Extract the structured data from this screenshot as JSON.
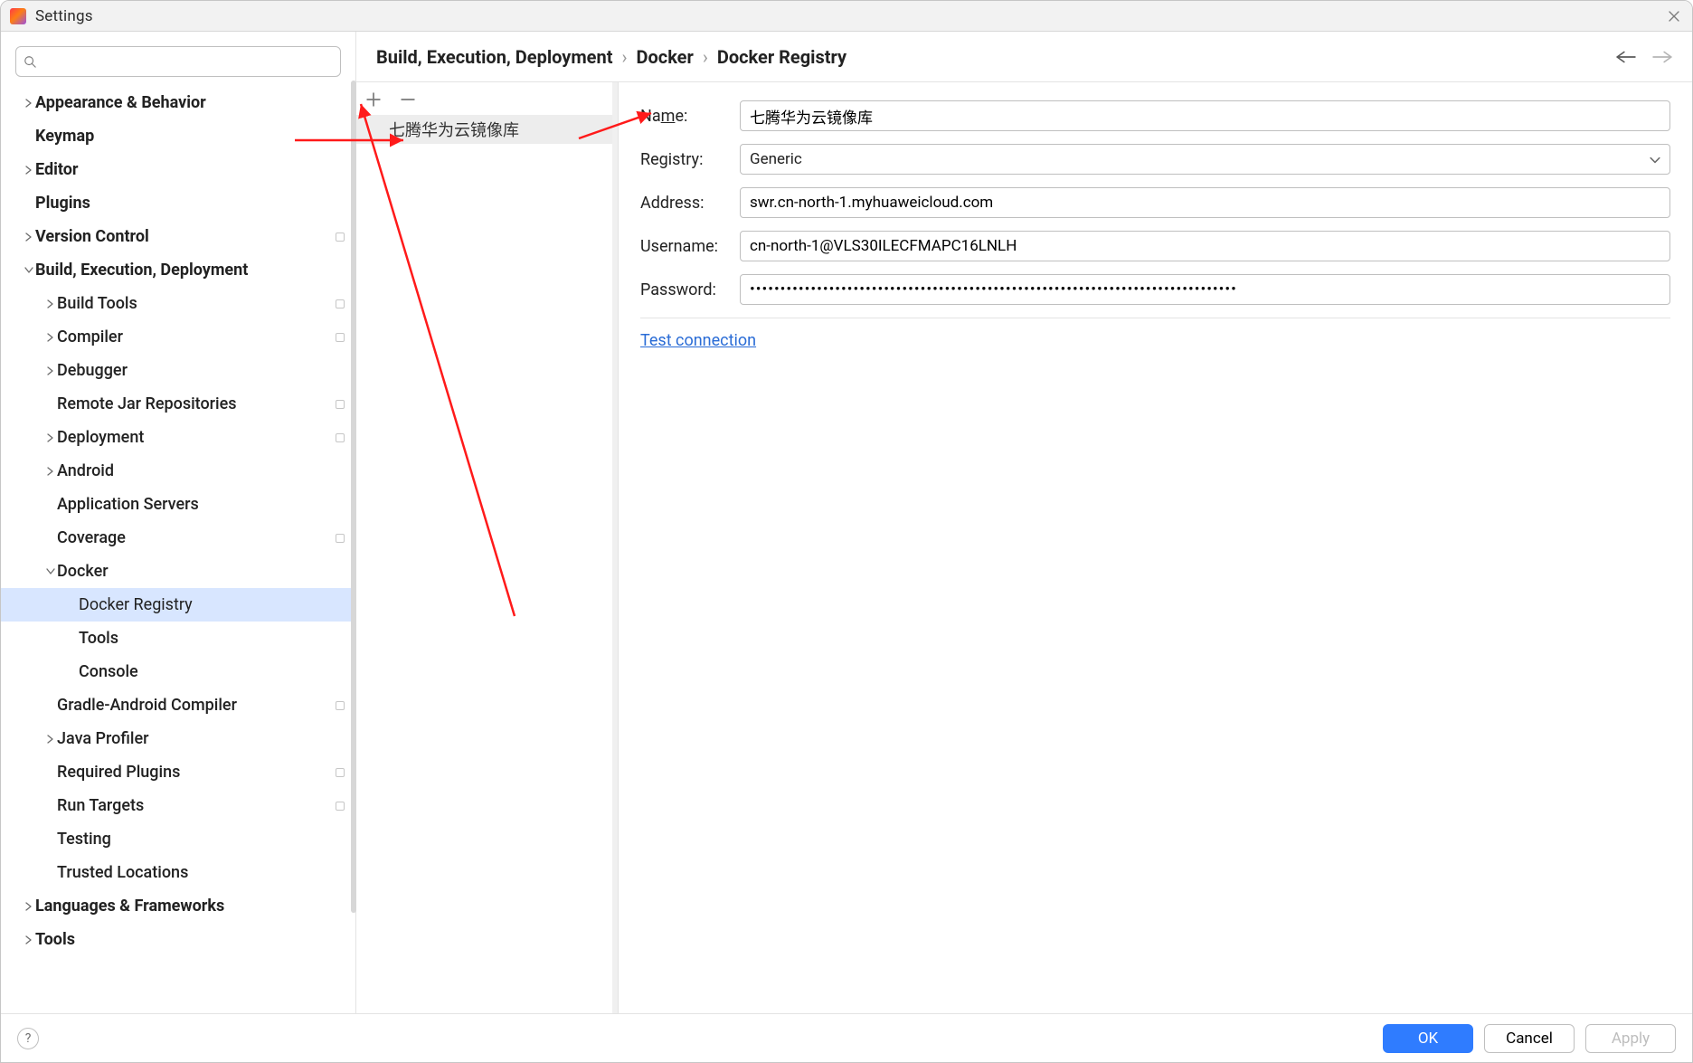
{
  "title": "Settings",
  "search": {
    "placeholder": ""
  },
  "sidebar": {
    "items": [
      {
        "label": "Appearance & Behavior",
        "depth": 0,
        "expandable": true,
        "expanded": false,
        "bold": true
      },
      {
        "label": "Keymap",
        "depth": 0,
        "expandable": false,
        "bold": true
      },
      {
        "label": "Editor",
        "depth": 0,
        "expandable": true,
        "expanded": false,
        "bold": true
      },
      {
        "label": "Plugins",
        "depth": 0,
        "expandable": false,
        "bold": true
      },
      {
        "label": "Version Control",
        "depth": 0,
        "expandable": true,
        "expanded": false,
        "bold": true,
        "bullet": true
      },
      {
        "label": "Build, Execution, Deployment",
        "depth": 0,
        "expandable": true,
        "expanded": true,
        "bold": true
      },
      {
        "label": "Build Tools",
        "depth": 1,
        "expandable": true,
        "expanded": false,
        "bullet": true
      },
      {
        "label": "Compiler",
        "depth": 1,
        "expandable": true,
        "expanded": false,
        "bullet": true
      },
      {
        "label": "Debugger",
        "depth": 1,
        "expandable": true,
        "expanded": false
      },
      {
        "label": "Remote Jar Repositories",
        "depth": 1,
        "expandable": false,
        "bullet": true
      },
      {
        "label": "Deployment",
        "depth": 1,
        "expandable": true,
        "expanded": false,
        "bullet": true
      },
      {
        "label": "Android",
        "depth": 1,
        "expandable": true,
        "expanded": false
      },
      {
        "label": "Application Servers",
        "depth": 1,
        "expandable": false
      },
      {
        "label": "Coverage",
        "depth": 1,
        "expandable": false,
        "bullet": true
      },
      {
        "label": "Docker",
        "depth": 1,
        "expandable": true,
        "expanded": true
      },
      {
        "label": "Docker Registry",
        "depth": 2,
        "expandable": false,
        "selected": true
      },
      {
        "label": "Tools",
        "depth": 2,
        "expandable": false
      },
      {
        "label": "Console",
        "depth": 2,
        "expandable": false
      },
      {
        "label": "Gradle-Android Compiler",
        "depth": 1,
        "expandable": false,
        "bullet": true
      },
      {
        "label": "Java Profiler",
        "depth": 1,
        "expandable": true,
        "expanded": false
      },
      {
        "label": "Required Plugins",
        "depth": 1,
        "expandable": false,
        "bullet": true
      },
      {
        "label": "Run Targets",
        "depth": 1,
        "expandable": false,
        "bullet": true
      },
      {
        "label": "Testing",
        "depth": 1,
        "expandable": false
      },
      {
        "label": "Trusted Locations",
        "depth": 1,
        "expandable": false
      },
      {
        "label": "Languages & Frameworks",
        "depth": 0,
        "expandable": true,
        "expanded": false,
        "bold": true
      },
      {
        "label": "Tools",
        "depth": 0,
        "expandable": true,
        "expanded": false,
        "bold": true
      }
    ]
  },
  "breadcrumb": {
    "parts": [
      "Build, Execution, Deployment",
      "Docker",
      "Docker Registry"
    ]
  },
  "registries": {
    "items": [
      {
        "label": "七腾华为云镜像库"
      }
    ]
  },
  "form": {
    "name": {
      "label_pre": "Na",
      "label_ul": "m",
      "label_post": "e:",
      "value": "七腾华为云镜像库"
    },
    "registry": {
      "label": "Registry:",
      "value": "Generic"
    },
    "address": {
      "label": "Address:",
      "value": "swr.cn-north-1.myhuaweicloud.com"
    },
    "username": {
      "label": "Username:",
      "value": "cn-north-1@VLS30ILECFMAPC16LNLH"
    },
    "password": {
      "label": "Password:",
      "value": "••••••••••••••••••••••••••••••••••••••••••••••••••••••••••••••••••••••••••••••••"
    },
    "test_link": "Test connection"
  },
  "footer": {
    "ok": "OK",
    "cancel": "Cancel",
    "apply": "Apply"
  }
}
